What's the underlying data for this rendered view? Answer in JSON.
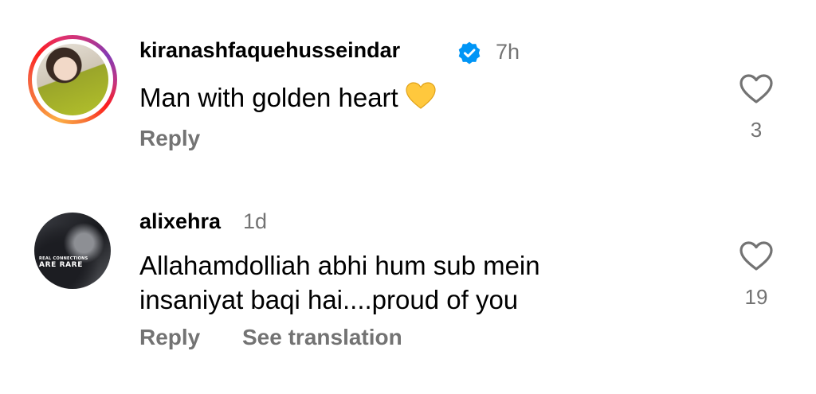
{
  "comments": [
    {
      "username": "kiranashfaquehusseindar",
      "verified": true,
      "time": "7h",
      "text": "Man with golden heart",
      "emoji": "yellow-heart",
      "reply_label": "Reply",
      "likes": "3"
    },
    {
      "username": "alixehra",
      "verified": false,
      "time": "1d",
      "lines": [
        "Allahamdolliah abhi hum sub mein",
        "insaniyat baqi hai....proud of you"
      ],
      "reply_label": "Reply",
      "translate_label": "See translation",
      "likes": "19",
      "avatar_text": {
        "line1": "REAL CONNECTIONS",
        "line2": "ARE RARE"
      }
    }
  ],
  "colors": {
    "secondary_text": "#737373",
    "verified_blue": "#0095f6",
    "yellow_heart": "#ffc83d"
  }
}
